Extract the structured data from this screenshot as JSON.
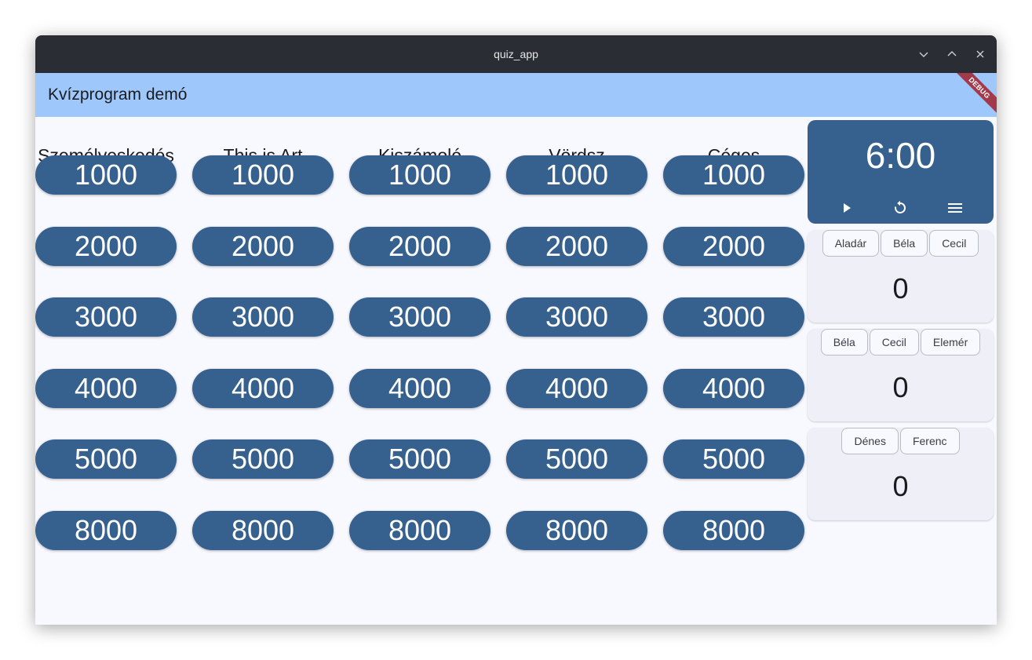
{
  "window": {
    "title": "quiz_app"
  },
  "appbar": {
    "title": "Kvízprogram demó",
    "debug_label": "DEBUG"
  },
  "board": {
    "categories": [
      {
        "name": "Személyeskedés",
        "values": [
          "1000",
          "2000",
          "3000",
          "4000",
          "5000",
          "8000"
        ]
      },
      {
        "name": "This is Art",
        "values": [
          "1000",
          "2000",
          "3000",
          "4000",
          "5000",
          "8000"
        ]
      },
      {
        "name": "Kiszámoló",
        "values": [
          "1000",
          "2000",
          "3000",
          "4000",
          "5000",
          "8000"
        ]
      },
      {
        "name": "Vördsz",
        "values": [
          "1000",
          "2000",
          "3000",
          "4000",
          "5000",
          "8000"
        ]
      },
      {
        "name": "Céges",
        "values": [
          "1000",
          "2000",
          "3000",
          "4000",
          "5000",
          "8000"
        ]
      }
    ]
  },
  "timer": {
    "time": "6:00",
    "icons": [
      "play-icon",
      "replay-icon",
      "menu-icon"
    ]
  },
  "teams": [
    {
      "members": [
        "Aladár",
        "Béla",
        "Cecil"
      ],
      "score": "0"
    },
    {
      "members": [
        "Béla",
        "Cecil",
        "Elemér"
      ],
      "score": "0"
    },
    {
      "members": [
        "Dénes",
        "Ferenc"
      ],
      "score": "0"
    }
  ],
  "colors": {
    "primary": "#36618e",
    "appbar": "#9ec8fc",
    "titlebar": "#2a2d33",
    "surface": "#f8f9ff",
    "card": "#eff0f7",
    "debug_ribbon": "#a33a4a"
  }
}
